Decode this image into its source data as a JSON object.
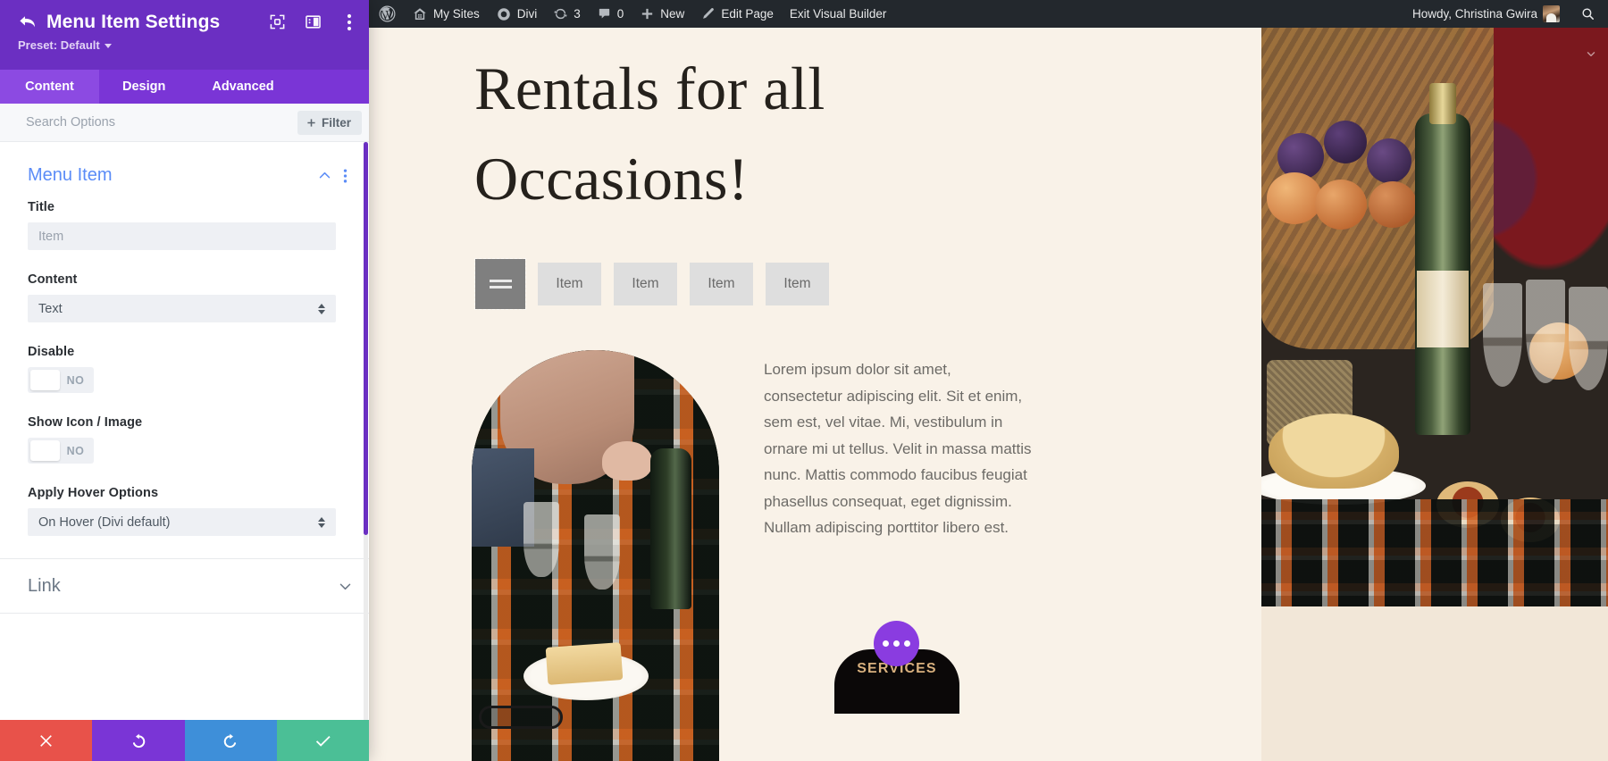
{
  "settings_panel": {
    "title": "Menu Item Settings",
    "preset_label": "Preset: Default",
    "back_icon": "back-arrow-icon",
    "header_icons": [
      "focus-target-icon",
      "panel-layout-icon",
      "vertical-dots-icon"
    ],
    "tabs": [
      {
        "label": "Content",
        "active": true
      },
      {
        "label": "Design",
        "active": false
      },
      {
        "label": "Advanced",
        "active": false
      }
    ],
    "search_placeholder": "Search Options",
    "filter_label": "Filter",
    "group": {
      "title": "Menu Item",
      "collapse_icon": "chevron-up-icon",
      "more_icon": "vertical-dots-icon"
    },
    "fields": {
      "title": {
        "label": "Title",
        "value": "",
        "placeholder": "Item"
      },
      "content": {
        "label": "Content",
        "value": "Text"
      },
      "disable": {
        "label": "Disable",
        "value": "NO"
      },
      "show_icon_image": {
        "label": "Show Icon / Image",
        "value": "NO"
      },
      "apply_hover": {
        "label": "Apply Hover Options",
        "value": "On Hover (Divi default)"
      }
    },
    "collapsed_section": {
      "title": "Link",
      "icon": "chevron-down-icon"
    },
    "footer_buttons": [
      {
        "name": "cancel",
        "icon": "x-icon",
        "color": "#e8524a"
      },
      {
        "name": "undo",
        "icon": "undo-icon",
        "color": "#7a35d6"
      },
      {
        "name": "redo",
        "icon": "redo-icon",
        "color": "#3e8fd9"
      },
      {
        "name": "save",
        "icon": "check-icon",
        "color": "#4bbf96"
      }
    ]
  },
  "admin_bar": {
    "wp_logo": "wordpress-logo-icon",
    "items": [
      {
        "label": "My Sites",
        "icon": "sites-icon"
      },
      {
        "label": "Divi",
        "icon": "divi-icon"
      },
      {
        "label": "3",
        "icon": "updates-icon"
      },
      {
        "label": "0",
        "icon": "comments-icon"
      },
      {
        "label": "New",
        "icon": "plus-icon"
      },
      {
        "label": "Edit Page",
        "icon": "pencil-icon"
      },
      {
        "label": "Exit Visual Builder",
        "icon": ""
      }
    ],
    "howdy": "Howdy, Christina Gwira",
    "search_icon": "search-icon"
  },
  "page": {
    "heading_lines": [
      "Rentals for all",
      "Occasions!"
    ],
    "menu": {
      "burger_icon": "hamburger-menu-icon",
      "items": [
        "Item",
        "Item",
        "Item",
        "Item"
      ]
    },
    "body_text": "Lorem ipsum dolor sit amet, consectetur adipiscing elit. Sit et enim, sem est, vel vitae. Mi, vestibulum in ornare mi ut tellus. Velit in massa mattis nunc. Mattis commodo faucibus feugiat phasellus consequat, eget dignissim. Nullam adipiscing porttitor libero est.",
    "services_button": "SERVICES",
    "dots_icon": "ellipsis-icon"
  },
  "colors": {
    "panel_purple": "#6b2fc2",
    "tab_purple": "#8c4ae2",
    "group_blue": "#5b8cf7",
    "page_cream": "#f9f2e8",
    "services_gold": "#d8b07e",
    "admin_dark": "#23282d"
  }
}
